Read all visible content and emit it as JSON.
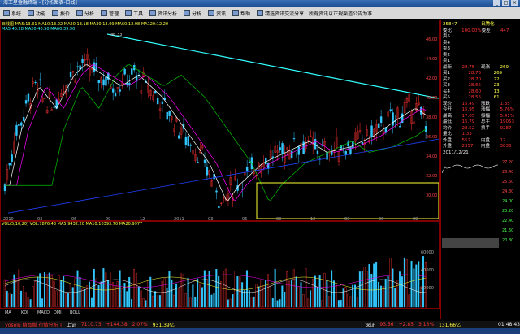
{
  "window": {
    "title": "海王星金融终端 - [分析图表-日线]",
    "min_label": "_",
    "max_label": "□",
    "close_label": "×"
  },
  "menu": [
    {
      "id": "file",
      "label": "系统"
    },
    {
      "id": "func",
      "label": "功能"
    },
    {
      "id": "quote",
      "label": "报价"
    },
    {
      "id": "analysis",
      "label": "分析"
    },
    {
      "id": "manage",
      "label": "管理"
    },
    {
      "id": "tools",
      "label": "工具"
    },
    {
      "id": "info",
      "label": "资讯分析"
    },
    {
      "id": "trade",
      "label": "分析"
    },
    {
      "id": "global",
      "label": "资讯"
    },
    {
      "id": "help",
      "label": "帮助"
    },
    {
      "id": "msg",
      "label": "精选资讯交流分享，所有资讯以正规渠道公告为准"
    }
  ],
  "chart": {
    "legend1": "日线图   MA5:13.31  MA10:13.22  MA20:13.18  MA30:13.09  MA60:12.98  MA120:12.20",
    "legend2": "MA5:40.28  MA20:40.50  MA60:39.90",
    "price_ticks": [
      "46.00",
      "44.00",
      "42.00",
      "40.00",
      "38.00",
      "36.00",
      "34.00",
      "32.00",
      "30.00"
    ],
    "date_ticks": [
      "2010",
      "03",
      "06",
      "09",
      "12",
      "2011",
      "03",
      "06",
      "09",
      "12",
      "03",
      "06",
      "09"
    ],
    "low_label": "30.68",
    "high_label": "46.33",
    "vol_legend": "VOL(5,10,20)  VOL:7876.43  MA5:9432.20  MA10:10393.70  MA20:9977",
    "vol_ticks": [
      "60000",
      "40000",
      "20000"
    ],
    "bottom_labels": [
      "MA",
      "KDJ",
      "MACD",
      "DMI",
      "BOLL"
    ]
  },
  "quote": {
    "header": {
      "code": "25847",
      "name": "日腾化"
    },
    "weibi_label": "委比",
    "weibi_val": "100.00%",
    "weicha_label": "委差",
    "weicha_val": "447",
    "sells": [
      {
        "label": "卖5",
        "price": "",
        "vol": ""
      },
      {
        "label": "卖4",
        "price": "",
        "vol": ""
      },
      {
        "label": "卖3",
        "price": "",
        "vol": ""
      },
      {
        "label": "卖2",
        "price": "",
        "vol": ""
      },
      {
        "label": "卖1",
        "price": "",
        "vol": ""
      }
    ],
    "latest_label": "最新",
    "latest_price": "28.75",
    "latest_extra": "现涨",
    "latest_vol": "269",
    "buys": [
      {
        "label": "买1",
        "price": "28.75",
        "vol": "269"
      },
      {
        "label": "买2",
        "price": "28.70",
        "vol": "22"
      },
      {
        "label": "买3",
        "price": "28.65",
        "vol": "23"
      },
      {
        "label": "买4",
        "price": "28.60",
        "vol": "13"
      },
      {
        "label": "买5",
        "price": "28.55",
        "vol": "61"
      }
    ],
    "stats": [
      {
        "a": "现价",
        "b": "15.49",
        "c": "涨跌",
        "d": "1.35"
      },
      {
        "a": "今开",
        "b": "15.95",
        "c": "涨幅",
        "d": "5.76%"
      },
      {
        "a": "最高",
        "b": "17.05",
        "c": "振幅",
        "d": "5.41%"
      },
      {
        "a": "最低",
        "b": "15.79",
        "c": "总手",
        "d": "19053"
      },
      {
        "a": "均价",
        "b": "28.52",
        "c": "换手",
        "d": "9287"
      },
      {
        "a": "量比",
        "b": "1.33",
        "c": "",
        "d": ""
      },
      {
        "a": "外盘",
        "b": "552",
        "c": "内盘",
        "d": "17"
      },
      {
        "a": "外盘",
        "b": "2357",
        "c": "内盘",
        "d": "3836"
      }
    ],
    "date": "2011/12/21",
    "mini_ticks": [
      "27.20",
      "26.40",
      "25.60",
      "24.80",
      "24.00",
      "23.20",
      "22.40",
      "21.60",
      "20.80"
    ]
  },
  "status": {
    "index1_name": "上证",
    "index1_val": "7110.73",
    "index1_chg": "+144.38",
    "index1_pct": "2.07%",
    "index1_amt": "931.39亿",
    "index2_name": "深证",
    "index2_val": "93.56",
    "index2_chg": "+2.85",
    "index2_pct": "3.13%",
    "index2_amt": "131.66亿",
    "left_label": "[ yosolu 精品版 行情分析 ]",
    "time": "01:48:43"
  }
}
